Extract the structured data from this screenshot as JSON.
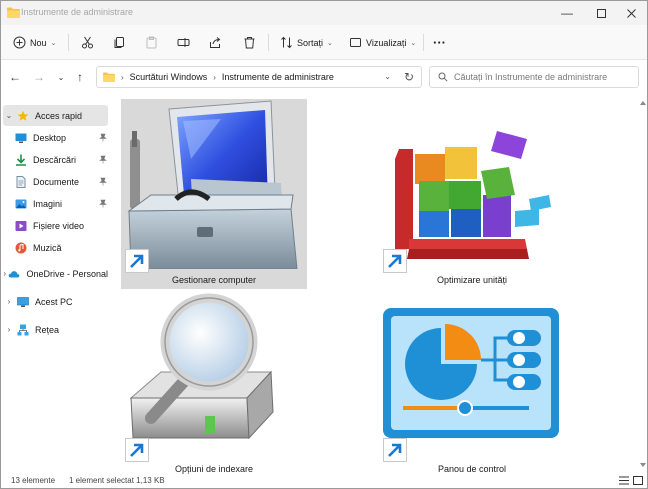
{
  "window": {
    "title": "Instrumente de administrare",
    "controls": [
      "minimize",
      "maximize",
      "close"
    ]
  },
  "toolbar": {
    "new_label": "Nou",
    "sort_label": "Sortați",
    "view_label": "Vizualizați",
    "more_label": "···"
  },
  "addressbar": {
    "breadcrumb": [
      "Scurtături Windows",
      "Instrumente de administrare"
    ]
  },
  "search": {
    "placeholder": "Căutați în Instrumente de administrare"
  },
  "sidebar": {
    "items": [
      {
        "label": "Acces rapid",
        "icon": "star-icon"
      },
      {
        "label": "Desktop",
        "icon": "desktop-icon"
      },
      {
        "label": "Descărcări",
        "icon": "download-icon"
      },
      {
        "label": "Documente",
        "icon": "document-icon"
      },
      {
        "label": "Imagini",
        "icon": "image-icon"
      },
      {
        "label": "Fișiere video",
        "icon": "video-icon"
      },
      {
        "label": "Muzică",
        "icon": "music-icon"
      },
      {
        "label": "OneDrive - Personal",
        "icon": "cloud-icon"
      },
      {
        "label": "Acest PC",
        "icon": "pc-icon"
      },
      {
        "label": "Rețea",
        "icon": "network-icon"
      }
    ]
  },
  "files": [
    {
      "label": "Gestionare computer",
      "icon": "computer-management-icon"
    },
    {
      "label": "Optimizare unități",
      "icon": "defragment-icon"
    },
    {
      "label": "Opțiuni de indexare",
      "icon": "indexing-options-icon"
    },
    {
      "label": "Panou de control",
      "icon": "control-panel-icon"
    }
  ],
  "status": {
    "count": "13 elemente",
    "selection": "1 element selectat  1,13 KB"
  },
  "colors": {
    "accent": "#0067c0",
    "folder": "#f7c34a",
    "selection": "#d9d9d9"
  }
}
